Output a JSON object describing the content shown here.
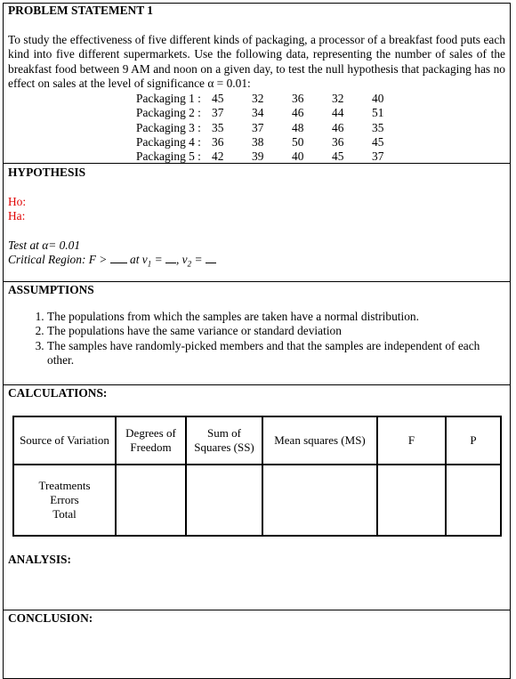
{
  "problem": {
    "heading": "PROBLEM STATEMENT 1",
    "text": "To study the effectiveness of five different kinds of packaging, a processor of a breakfast food puts each kind into five different supermarkets. Use the following data, representing the number of sales of the breakfast food between 9 AM and noon on  a given day, to test the null hypothesis that packaging has no effect  on sales at the level of significance α = 0.01:",
    "packaging": [
      {
        "label": "Packaging 1 :",
        "values": [
          "45",
          "32",
          "36",
          "32",
          "40"
        ]
      },
      {
        "label": "Packaging 2 :",
        "values": [
          "37",
          "34",
          "46",
          "44",
          "51"
        ]
      },
      {
        "label": "Packaging 3 :",
        "values": [
          "35",
          "37",
          "48",
          "46",
          "35"
        ]
      },
      {
        "label": "Packaging 4 :",
        "values": [
          "36",
          "38",
          "50",
          "36",
          "45"
        ]
      },
      {
        "label": "Packaging 5 :",
        "values": [
          "42",
          "39",
          "40",
          "45",
          "37"
        ]
      }
    ]
  },
  "hypothesis": {
    "heading": "HYPOTHESIS",
    "ho": "Ho:",
    "ha": "Ha:",
    "test_at": "Test at  α= 0.01",
    "critical_prefix": "Critical Region: F >",
    "critical_at": "at v",
    "sub1": "1",
    "eq1": " = ",
    "comma": ", v",
    "sub2": "2",
    "eq2": " = "
  },
  "assumptions": {
    "heading": "ASSUMPTIONS",
    "items": [
      "The populations from which the samples are taken have a normal distribution.",
      "The populations have the same variance or standard deviation",
      "The samples have randomly-picked members and that the samples are independent of each other."
    ]
  },
  "calculations": {
    "heading": "CALCULATIONS:",
    "table": {
      "headers": [
        "Source of Variation",
        "Degrees of Freedom",
        "Sum of Squares (SS)",
        "Mean squares (MS)",
        "F",
        "P"
      ],
      "rows": [
        "Treatments",
        "Errors",
        "Total"
      ]
    }
  },
  "analysis": {
    "heading": "ANALYSIS:"
  },
  "conclusion": {
    "heading": "CONCLUSION:"
  },
  "colors": {
    "hypothesis_labels": "#e00000"
  }
}
